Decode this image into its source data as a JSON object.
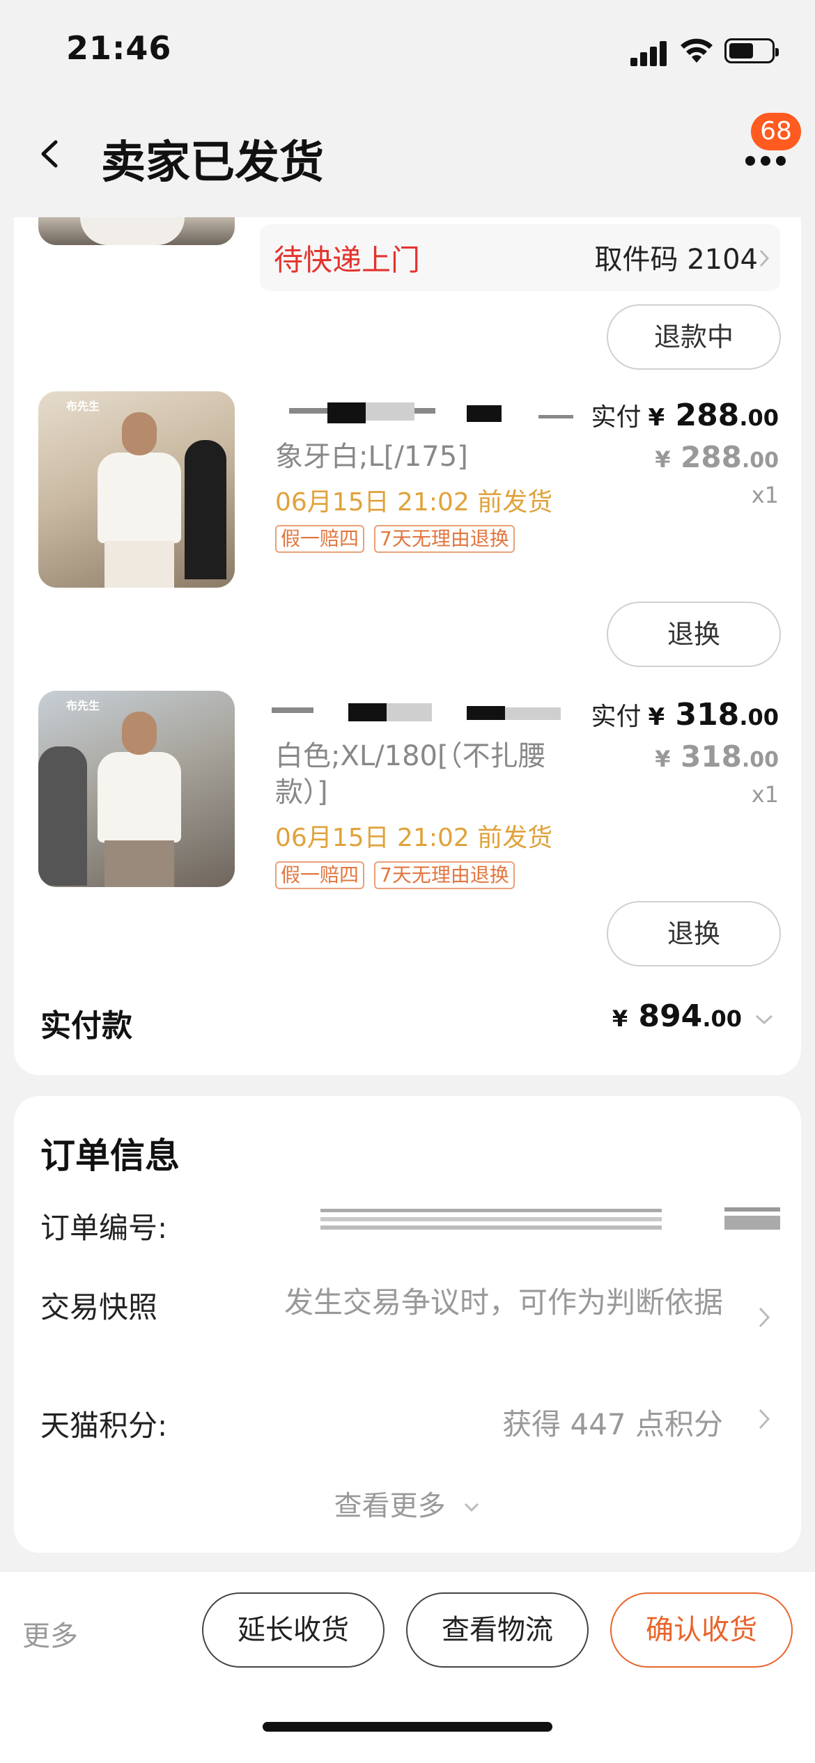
{
  "status_bar": {
    "time": "21:46"
  },
  "nav": {
    "title": "卖家已发货",
    "badge_count": "68"
  },
  "pickup": {
    "status": "待快递上门",
    "code_label": "取件码 2104"
  },
  "buttons": {
    "refund_in_progress": "退款中",
    "exchange": "退换"
  },
  "items": [
    {
      "brand": "布先生",
      "variant": "象牙白;L[/175]",
      "ship_time": "06月15日 21:02 前发货",
      "tags": [
        "假一赔四",
        "7天无理由退换"
      ],
      "paid_label": "实付",
      "paid_currency": "¥",
      "paid_int": "288",
      "paid_dec": ".00",
      "orig_currency": "¥",
      "orig_int": "288",
      "orig_dec": ".00",
      "qty": "x1"
    },
    {
      "brand": "布先生",
      "variant": "白色;XL/180[（不扎腰款）]",
      "ship_time": "06月15日 21:02 前发货",
      "tags": [
        "假一赔四",
        "7天无理由退换"
      ],
      "paid_label": "实付",
      "paid_currency": "¥",
      "paid_int": "318",
      "paid_dec": ".00",
      "orig_currency": "¥",
      "orig_int": "318",
      "orig_dec": ".00",
      "qty": "x1"
    }
  ],
  "total": {
    "label": "实付款",
    "currency": "¥",
    "int": "894",
    "dec": ".00"
  },
  "order_info": {
    "title": "订单信息",
    "order_no_label": "订单编号:",
    "snapshot_label": "交易快照",
    "snapshot_value": "发生交易争议时，可作为判断依据",
    "points_label": "天猫积分:",
    "points_value": "获得 447 点积分",
    "see_more": "查看更多"
  },
  "bottom_bar": {
    "more": "更多",
    "extend": "延长收货",
    "logistics": "查看物流",
    "confirm": "确认收货"
  },
  "colors": {
    "accent": "#e8642c",
    "red": "#e3332e",
    "gold": "#e0a23a",
    "badge": "#ff5a1f"
  }
}
